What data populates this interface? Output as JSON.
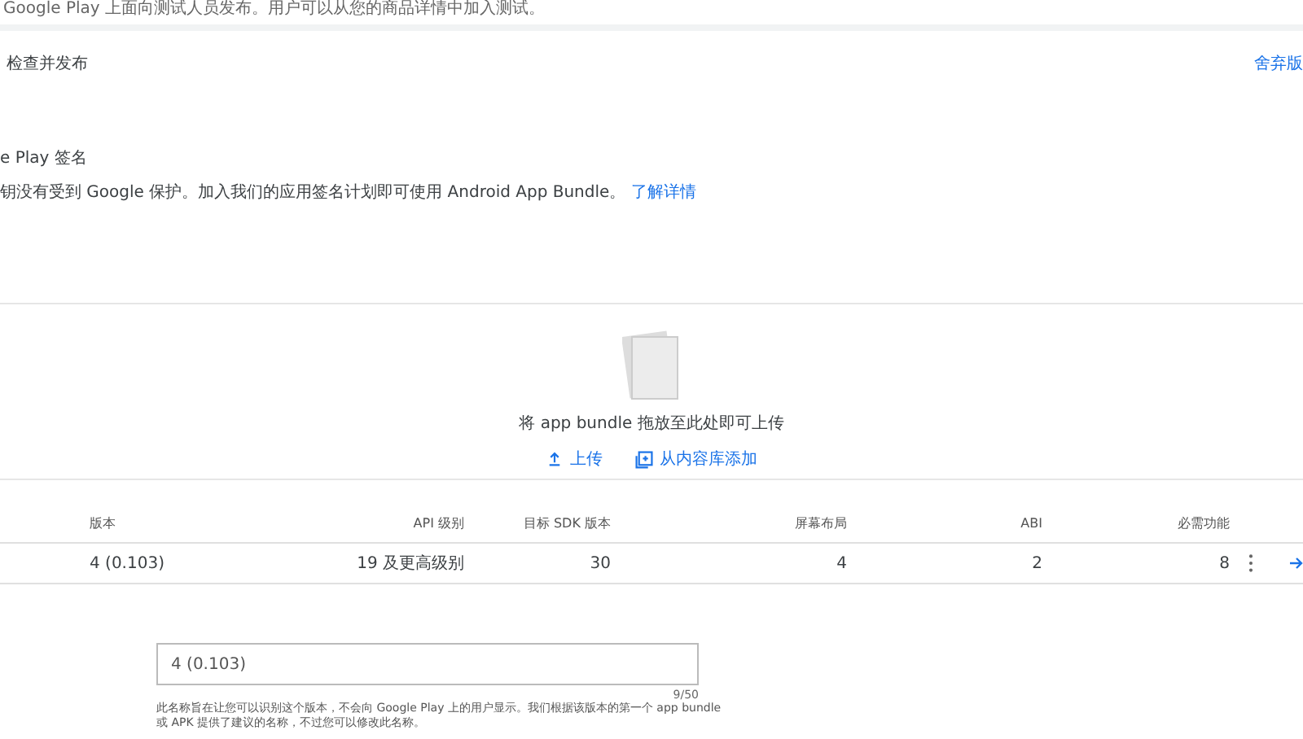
{
  "intro": "Google Play 上面向测试人员发布。用户可以从您的商品详情中加入测试。",
  "review": {
    "title": "检查并发布",
    "action": "舍弃版"
  },
  "signing": {
    "title": "e Play 签名",
    "text": "钥没有受到 Google 保护。加入我们的应用签名计划即可使用 Android App Bundle。",
    "link": "了解详情"
  },
  "dropzone": {
    "hint": "将 app bundle 拖放至此处即可上传",
    "buttons": [
      {
        "kind": "upload",
        "label": "上传"
      },
      {
        "kind": "library",
        "label": "从内容库添加"
      }
    ]
  },
  "table": {
    "columns": [
      "版本",
      "API 级别",
      "目标 SDK 版本",
      "屏幕布局",
      "ABI",
      "必需功能"
    ],
    "rows": [
      [
        "4 (0.103)",
        "19 及更高级别",
        "30",
        "4",
        "2",
        "8"
      ]
    ]
  },
  "release_name": {
    "value": "4 (0.103)",
    "counter": "9/50",
    "helper": "此名称旨在让您可以识别这个版本，不会向 Google Play 上的用户显示。我们根据该版本的第一个 app bundle",
    "helper_2": "或 APK 提供了建议的名称，不过您可以修改此名称。"
  }
}
